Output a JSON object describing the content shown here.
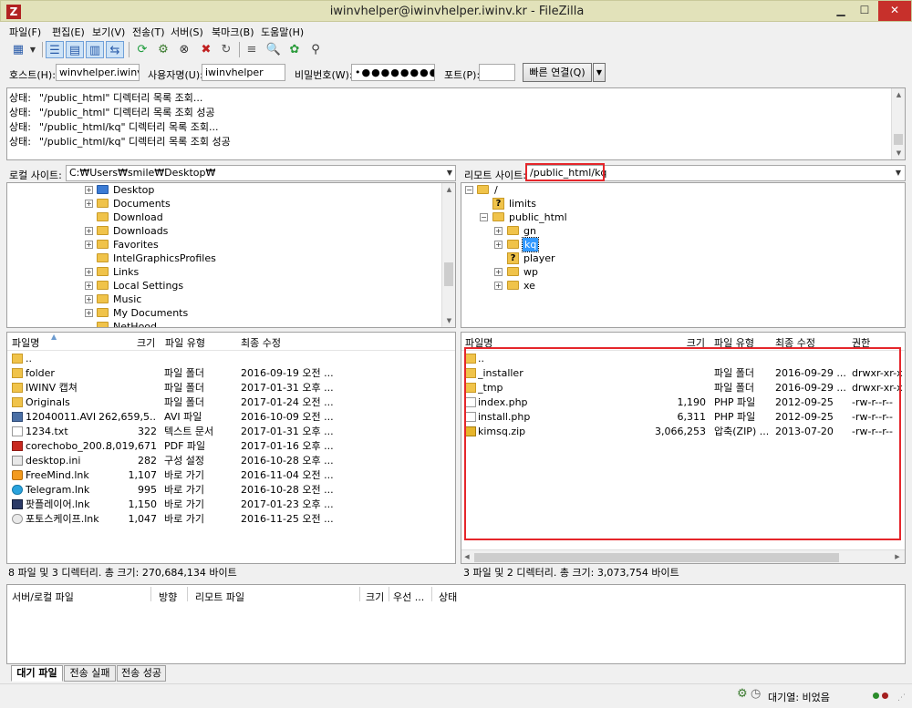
{
  "window": {
    "title": "iwinvhelper@iwinvhelper.iwinv.kr - FileZilla",
    "app_icon": "Z"
  },
  "menu": [
    "파일(F)",
    "편집(E)",
    "보기(V)",
    "전송(T)",
    "서버(S)",
    "북마크(B)",
    "도움말(H)"
  ],
  "quickconnect": {
    "host_label": "호스트(H):",
    "host_value": "winvhelper.iwinv.kr",
    "user_label": "사용자명(U):",
    "user_value": "iwinvhelper",
    "pass_label": "비밀번호(W):",
    "pass_value": "•●●●●●●●●",
    "port_label": "포트(P):",
    "port_value": "",
    "connect_label": "빠른 연결(Q)"
  },
  "log": [
    {
      "status": "상태:",
      "message": "\"/public_html\" 디렉터리 목록 조회..."
    },
    {
      "status": "상태:",
      "message": "\"/public_html\" 디렉터리 목록 조회 성공"
    },
    {
      "status": "상태:",
      "message": "\"/public_html/kq\" 디렉터리 목록 조회..."
    },
    {
      "status": "상태:",
      "message": "\"/public_html/kq\" 디렉터리 목록 조회 성공"
    }
  ],
  "local": {
    "site_label": "로컬 사이트:",
    "site_path": "C:₩Users₩smile₩Desktop₩",
    "tree": [
      "Desktop",
      "Documents",
      "Download",
      "Downloads",
      "Favorites",
      "IntelGraphicsProfiles",
      "Links",
      "Local Settings",
      "Music",
      "My Documents",
      "NetHood"
    ],
    "columns": {
      "name": "파일명",
      "size": "크기",
      "type": "파일 유형",
      "modified": "최종 수정"
    },
    "files": [
      {
        "name": "..",
        "size": "",
        "type": "",
        "modified": ""
      },
      {
        "name": "folder",
        "size": "",
        "type": "파일 폴더",
        "modified": "2016-09-19 오전 ..."
      },
      {
        "name": "IWINV 캡쳐",
        "size": "",
        "type": "파일 폴더",
        "modified": "2017-01-31 오후 ..."
      },
      {
        "name": "Originals",
        "size": "",
        "type": "파일 폴더",
        "modified": "2017-01-24 오전 ..."
      },
      {
        "name": "12040011.AVI",
        "size": "262,659,5...",
        "type": "AVI 파일",
        "modified": "2016-10-09 오전 ..."
      },
      {
        "name": "1234.txt",
        "size": "322",
        "type": "텍스트 문서",
        "modified": "2017-01-31 오후 ..."
      },
      {
        "name": "corechobo_200...",
        "size": "8,019,671",
        "type": "PDF 파일",
        "modified": "2017-01-16 오후 ..."
      },
      {
        "name": "desktop.ini",
        "size": "282",
        "type": "구성 설정",
        "modified": "2016-10-28 오후 ..."
      },
      {
        "name": "FreeMind.lnk",
        "size": "1,107",
        "type": "바로 가기",
        "modified": "2016-11-04 오전 ..."
      },
      {
        "name": "Telegram.lnk",
        "size": "995",
        "type": "바로 가기",
        "modified": "2016-10-28 오전 ..."
      },
      {
        "name": "팟플레이어.lnk",
        "size": "1,150",
        "type": "바로 가기",
        "modified": "2017-01-23 오후 ..."
      },
      {
        "name": "포토스케이프.lnk",
        "size": "1,047",
        "type": "바로 가기",
        "modified": "2016-11-25 오전 ..."
      }
    ],
    "status": "8 파일 및 3 디렉터리. 총 크기: 270,684,134 바이트"
  },
  "remote": {
    "site_label": "리모트 사이트:",
    "site_path": "/public_html/kq",
    "tree": [
      "/",
      "limits",
      "public_html",
      "gn",
      "kq",
      "player",
      "wp",
      "xe"
    ],
    "columns": {
      "name": "파일명",
      "size": "크기",
      "type": "파일 유형",
      "modified": "최종 수정",
      "perm": "권한"
    },
    "files": [
      {
        "name": "..",
        "size": "",
        "type": "",
        "modified": "",
        "perm": ""
      },
      {
        "name": "_installer",
        "size": "",
        "type": "파일 폴더",
        "modified": "2016-09-29 ...",
        "perm": "drwxr-xr-x"
      },
      {
        "name": "_tmp",
        "size": "",
        "type": "파일 폴더",
        "modified": "2016-09-29 ...",
        "perm": "drwxr-xr-x"
      },
      {
        "name": "index.php",
        "size": "1,190",
        "type": "PHP 파일",
        "modified": "2012-09-25",
        "perm": "-rw-r--r--"
      },
      {
        "name": "install.php",
        "size": "6,311",
        "type": "PHP 파일",
        "modified": "2012-09-25",
        "perm": "-rw-r--r--"
      },
      {
        "name": "kimsq.zip",
        "size": "3,066,253",
        "type": "압축(ZIP) ...",
        "modified": "2013-07-20",
        "perm": "-rw-r--r--"
      }
    ],
    "status": "3 파일 및 2 디렉터리. 총 크기: 3,073,754 바이트"
  },
  "queue": {
    "columns": {
      "file": "서버/로컬 파일",
      "direction": "방향",
      "remote": "리모트 파일",
      "size": "크기",
      "priority": "우선 ...",
      "status": "상태"
    },
    "tabs": [
      "대기 파일",
      "전송 실패",
      "전송 성공"
    ]
  },
  "footer": {
    "queue_status": "대기열: 비었음"
  }
}
